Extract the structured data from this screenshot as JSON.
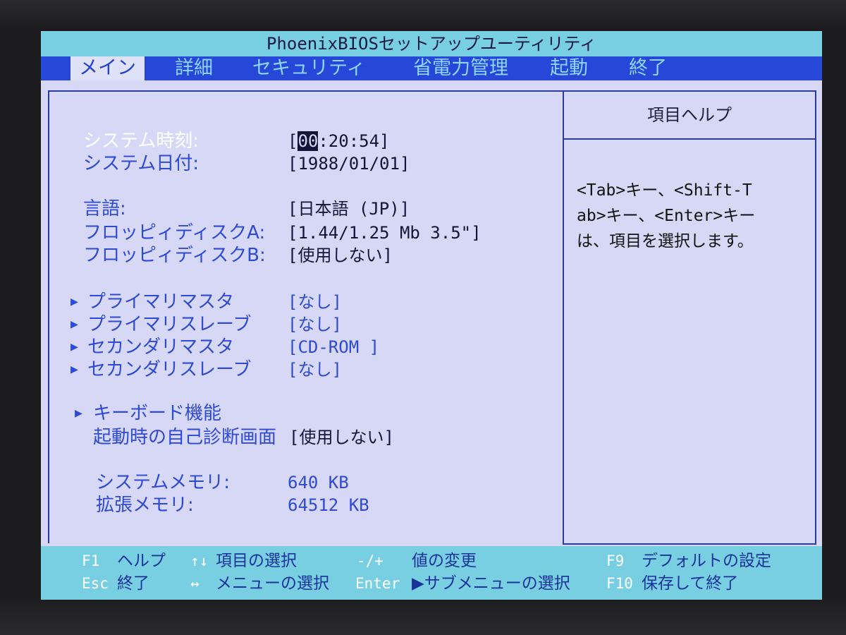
{
  "title": "PhoenixBIOSセットアップユーティリティ",
  "menu": [
    "メイン",
    "詳細",
    "セキュリティ",
    "省電力管理",
    "起動",
    "終了"
  ],
  "main": {
    "system_time_label": "システム時刻:",
    "system_time_cursor": "00",
    "system_time_rest": ":20:54]",
    "system_time_open": "[",
    "system_date_label": "システム日付:",
    "system_date_value": "[1988/01/01]",
    "language_label": "言語:",
    "language_value": "[日本語 (JP)]",
    "floppy_a_label": "フロッピィディスクA:",
    "floppy_a_value": "[1.44/1.25 Mb  3.5\"]",
    "floppy_b_label": "フロッピィディスクB:",
    "floppy_b_value": "[使用しない]",
    "primary_master_label": "プライマリマスタ",
    "primary_master_value": "[なし]",
    "primary_slave_label": "プライマリスレーブ",
    "primary_slave_value": "[なし]",
    "secondary_master_label": "セカンダリマスタ",
    "secondary_master_value": "[CD-ROM ]",
    "secondary_slave_label": "セカンダリスレーブ",
    "secondary_slave_value": "[なし]",
    "keyboard_label": "キーボード機能",
    "post_screen_label": "起動時の自己診断画面",
    "post_screen_value": "[使用しない]",
    "system_memory_label": "システムメモリ:",
    "system_memory_value": "640  KB",
    "extended_memory_label": "拡張メモリ:",
    "extended_memory_value": "64512  KB"
  },
  "help": {
    "title": "項目ヘルプ",
    "line1": "<Tab>キー、<Shift-T",
    "line2": "ab>キー、<Enter>キー",
    "line3": "は、項目を選択します。"
  },
  "footer": {
    "f1_key": "F1",
    "f1_text": "ヘルプ",
    "updown_key": "↑↓",
    "updown_text": "項目の選択",
    "plusminus_key": "-/+",
    "plusminus_text": "値の変更",
    "f9_key": "F9",
    "f9_text": "デフォルトの設定",
    "esc_key": "Esc",
    "esc_text": "終了",
    "leftright_key": "↔",
    "leftright_text": "メニューの選択",
    "enter_key": "Enter",
    "enter_text": "▶サブメニューの選択",
    "f10_key": "F10",
    "f10_text": "保存して終了"
  },
  "icons": {
    "submenu_arrow": "▶"
  },
  "colors": {
    "title_bar": "#78cfe2",
    "menu_bar": "#2747d8",
    "background": "#d6d8f6",
    "label_blue": "#2e49d4"
  }
}
